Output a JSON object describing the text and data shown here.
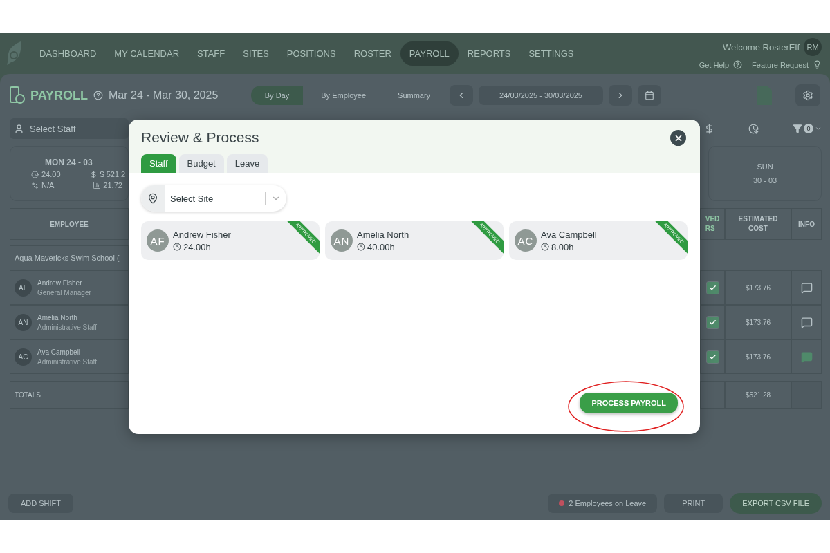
{
  "nav": {
    "items": [
      {
        "label": "DASHBOARD",
        "selected": false
      },
      {
        "label": "MY CALENDAR",
        "selected": false
      },
      {
        "label": "STAFF",
        "selected": false
      },
      {
        "label": "SITES",
        "selected": false
      },
      {
        "label": "POSITIONS",
        "selected": false
      },
      {
        "label": "ROSTER",
        "selected": false
      },
      {
        "label": "PAYROLL",
        "selected": true
      },
      {
        "label": "REPORTS",
        "selected": false
      },
      {
        "label": "SETTINGS",
        "selected": false
      }
    ],
    "welcome": "Welcome RosterElf",
    "avatar": "RM",
    "help": "Get Help",
    "feature_request": "Feature Request"
  },
  "header": {
    "title": "PAYROLL",
    "range": "Mar 24 - Mar 30, 2025",
    "views": [
      {
        "label": "By Day",
        "selected": true
      },
      {
        "label": "By Employee",
        "selected": false
      },
      {
        "label": "Summary",
        "selected": false
      }
    ],
    "date_range": "24/03/2025 - 30/03/2025"
  },
  "toolbar": {
    "staff_placeholder": "Select Staff",
    "filter_count": "0"
  },
  "first_day": {
    "label": "MON 24 - 03",
    "hours": "24.00",
    "cost": "$ 521.2",
    "percent": "N/A",
    "average": "21.72"
  },
  "last_day": {
    "weekday": "SUN",
    "date": "30 - 03"
  },
  "table": {
    "employee_header": "EMPLOYEE",
    "approved_header": [
      "VED",
      "RS"
    ],
    "cost_header": "ESTIMATED COST",
    "info_header": "INFO",
    "group": "Aqua Mavericks Swim School (",
    "rows": [
      {
        "initials": "AF",
        "name": "Andrew Fisher",
        "role": "General Manager",
        "approved": true,
        "cost": "$173.76",
        "note": false
      },
      {
        "initials": "AN",
        "name": "Amelia North",
        "role": "Administrative Staff",
        "approved": true,
        "cost": "$173.76",
        "note": false
      },
      {
        "initials": "AC",
        "name": "Ava Campbell",
        "role": "Administrative Staff",
        "approved": true,
        "cost": "$173.76",
        "note": true
      }
    ],
    "totals_label": "TOTALS",
    "totals_cost": "$521.28"
  },
  "footer": {
    "add_shift": "ADD SHIFT",
    "leave": "2 Employees on Leave",
    "print": "PRINT",
    "export": "EXPORT CSV FILE"
  },
  "modal": {
    "title": "Review & Process",
    "tabs": [
      {
        "label": "Staff",
        "selected": true
      },
      {
        "label": "Budget",
        "selected": false
      },
      {
        "label": "Leave",
        "selected": false
      }
    ],
    "site_placeholder": "Select Site",
    "staff": [
      {
        "initials": "AF",
        "name": "Andrew Fisher",
        "hours": "24.00h",
        "approved": true,
        "ribbon": "APPROVED"
      },
      {
        "initials": "AN",
        "name": "Amelia North",
        "hours": "40.00h",
        "approved": true,
        "ribbon": "APPROVED"
      },
      {
        "initials": "AC",
        "name": "Ava Campbell",
        "hours": "8.00h",
        "approved": true,
        "ribbon": "APPROVED"
      }
    ],
    "action": "PROCESS PAYROLL",
    "action_highlighted": true
  }
}
